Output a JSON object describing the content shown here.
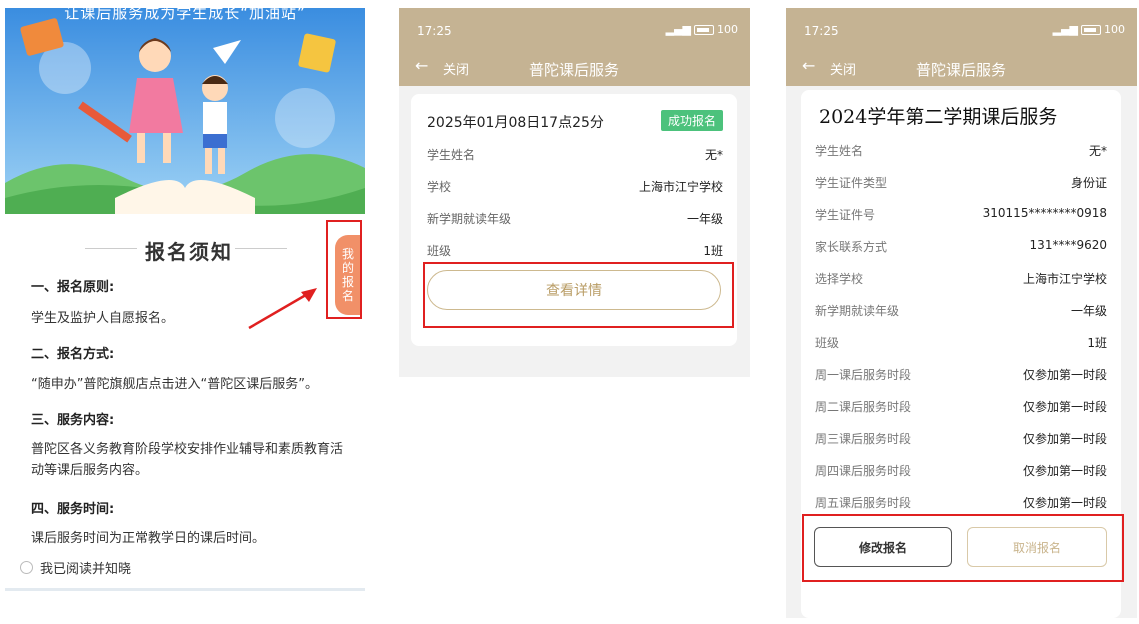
{
  "panel1": {
    "slogan": "让课后服务成为学生成长“加油站”",
    "notice_title": "报名须知",
    "sections": [
      {
        "heading": "一、报名原则:",
        "text": "学生及监护人自愿报名。"
      },
      {
        "heading": "二、报名方式:",
        "text": "“随申办”普陀旗舰店点击进入“普陀区课后服务”。"
      },
      {
        "heading": "三、服务内容:",
        "text": "普陀区各义务教育阶段学校安排作业辅导和素质教育活动等课后服务内容。"
      },
      {
        "heading": "四、服务时间:",
        "text": "课后服务时间为正常教学日的课后时间。"
      }
    ],
    "read_checkbox_label": "我已阅读并知晓",
    "my_registration_tab": [
      "我",
      "的",
      "报",
      "名"
    ]
  },
  "panel2": {
    "status_time": "17:25",
    "status_battery": "100",
    "nav_back": "←",
    "nav_close": "关闭",
    "nav_title": "普陀课后服务",
    "datetime": "2025年01月08日17点25分",
    "badge": "成功报名",
    "rows": [
      {
        "label": "学生姓名",
        "value": "无*"
      },
      {
        "label": "学校",
        "value": "上海市江宁学校"
      },
      {
        "label": "新学期就读年级",
        "value": "一年级"
      },
      {
        "label": "班级",
        "value": "1班"
      }
    ],
    "detail_button": "查看详情"
  },
  "panel3": {
    "status_time": "17:25",
    "status_battery": "100",
    "nav_back": "←",
    "nav_close": "关闭",
    "nav_title": "普陀课后服务",
    "card_title": "2024学年第二学期课后服务",
    "rows": [
      {
        "label": "学生姓名",
        "value": "无*"
      },
      {
        "label": "学生证件类型",
        "value": "身份证"
      },
      {
        "label": "学生证件号",
        "value": "310115********0918"
      },
      {
        "label": "家长联系方式",
        "value": "131****9620"
      },
      {
        "label": "选择学校",
        "value": "上海市江宁学校"
      },
      {
        "label": "新学期就读年级",
        "value": "一年级"
      },
      {
        "label": "班级",
        "value": "1班"
      },
      {
        "label": "周一课后服务时段",
        "value": "仅参加第一时段"
      },
      {
        "label": "周二课后服务时段",
        "value": "仅参加第一时段"
      },
      {
        "label": "周三课后服务时段",
        "value": "仅参加第一时段"
      },
      {
        "label": "周四课后服务时段",
        "value": "仅参加第一时段"
      },
      {
        "label": "周五课后服务时段",
        "value": "仅参加第一时段"
      }
    ],
    "modify_button": "修改报名",
    "cancel_button": "取消报名"
  },
  "colors": {
    "header": "#c5b393",
    "success_badge": "#4cc27c",
    "tab_orange": "#f19068",
    "highlight_red": "#e02020",
    "gold_text": "#b99d66"
  }
}
